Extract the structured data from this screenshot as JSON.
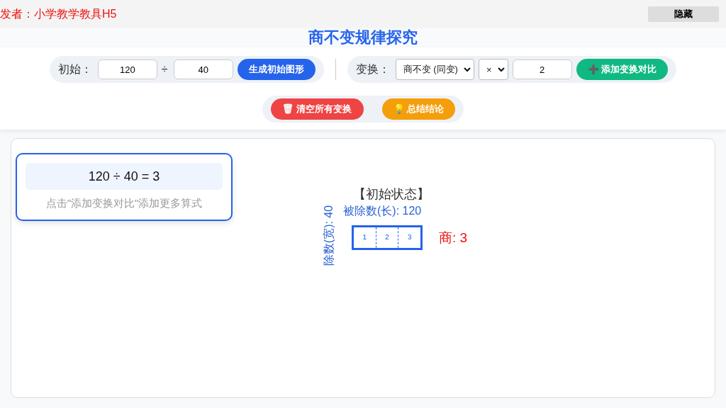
{
  "top_bar": {
    "author": "发者：小学教学教具H5",
    "hide_button": "隐藏"
  },
  "title": "商不变规律探究",
  "initial": {
    "label": "初始：",
    "dividend": "120",
    "operator": "÷",
    "divisor": "40",
    "button": "生成初始图形"
  },
  "transform": {
    "label": "变换：",
    "mode": "商不变 (同变)",
    "op": "×",
    "factor": "2",
    "button": "➕ 添加变换对比"
  },
  "actions": [
    {
      "kind": "danger",
      "label": "🗑 清空所有变换"
    },
    {
      "kind": "warning",
      "label": "💡 总结结论"
    }
  ],
  "equation_card": {
    "equation": "120 ÷ 40 = 3",
    "hint": "点击\"添加变换对比\"添加更多算式"
  },
  "figure": {
    "heading": "【初始状态】",
    "length_label": "被除数(长): 120",
    "width_label": "除数(宽): 40",
    "cells": [
      "1",
      "2",
      "3"
    ],
    "quotient": "商: 3"
  }
}
